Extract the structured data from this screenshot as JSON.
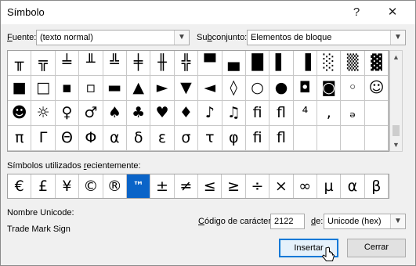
{
  "window": {
    "title": "Símbolo",
    "help_label": "?",
    "close_label": "✕"
  },
  "font": {
    "label_u": "F",
    "label_rest": "uente:",
    "value": "(texto normal)"
  },
  "subset": {
    "label_pre": "Su",
    "label_u": "b",
    "label_rest": "conjunto:",
    "value": "Elementos de bloque"
  },
  "symbols": [
    "╥",
    "╦",
    "╧",
    "╨",
    "╩",
    "╪",
    "╫",
    "╬",
    "▀",
    "▄",
    "█",
    "▌",
    "▐",
    "░",
    "▒",
    "▓",
    "■",
    "□",
    "▪",
    "▫",
    "▬",
    "▲",
    "►",
    "▼",
    "◄",
    "◊",
    "○",
    "●",
    "◘",
    "◙",
    "◦",
    "☺",
    "☻",
    "☼",
    "♀",
    "♂",
    "♠",
    "♣",
    "♥",
    "♦",
    "♪",
    "♫",
    "ﬁ",
    "ﬂ",
    "⁴",
    ",",
    "ₔ",
    "",
    "π",
    "Γ",
    "Θ",
    "Φ",
    "α",
    "δ",
    "ε",
    "σ",
    "τ",
    "φ",
    "ﬁ",
    "ﬂ",
    "",
    "",
    "",
    ""
  ],
  "recent": {
    "label_pre": "Símbolos utilizados ",
    "label_u": "r",
    "label_rest": "ecientemente:",
    "items": [
      "€",
      "£",
      "¥",
      "©",
      "®",
      "™",
      "±",
      "≠",
      "≤",
      "≥",
      "÷",
      "×",
      "∞",
      "µ",
      "α",
      "β"
    ]
  },
  "unicode_name": {
    "label": "Nombre Unicode:",
    "value": "Trade Mark Sign"
  },
  "char_code": {
    "label_u": "C",
    "label_rest": "ódigo de carácter:",
    "value": "2122"
  },
  "from": {
    "label_u": "d",
    "label_rest": "e:",
    "value": "Unicode (hex)"
  },
  "buttons": {
    "insert": "Insertar",
    "cancel": "Cerrar"
  },
  "icons": {
    "dropdown": "chevron-down-icon",
    "scroll_up": "chevron-up-icon",
    "scroll_down": "chevron-down-icon"
  },
  "colors": {
    "selection": "#0a64c8",
    "primary_border": "#0078d7"
  }
}
